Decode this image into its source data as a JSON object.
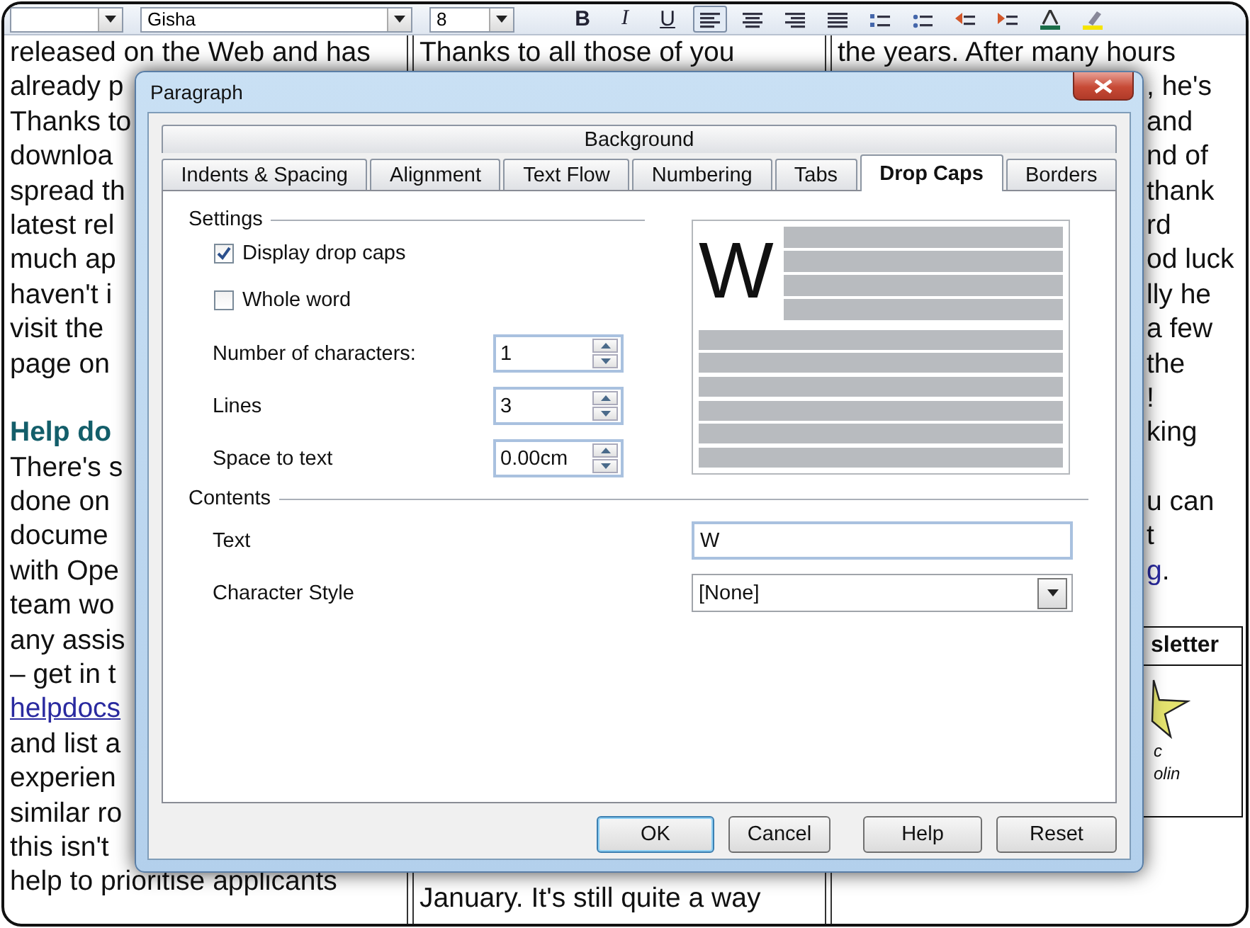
{
  "toolbar": {
    "font_name": "Gisha",
    "font_size": "8",
    "buttons": [
      {
        "kind": "bold",
        "label": "B"
      },
      {
        "kind": "italic",
        "label": "I"
      },
      {
        "kind": "underline",
        "label": "U"
      },
      {
        "kind": "align-left",
        "selected": true
      },
      {
        "kind": "align-center",
        "selected": false
      },
      {
        "kind": "align-right",
        "selected": false
      },
      {
        "kind": "justify",
        "selected": false
      },
      {
        "kind": "numbering"
      },
      {
        "kind": "bullets"
      },
      {
        "kind": "indent-less"
      },
      {
        "kind": "indent-more"
      },
      {
        "kind": "font-color"
      },
      {
        "kind": "highlight"
      }
    ]
  },
  "document": {
    "columns": [
      {
        "lines": [
          {
            "kind": "body",
            "text": "released on the Web and has"
          },
          {
            "kind": "body",
            "text": "already p"
          },
          {
            "kind": "body",
            "text": "Thanks to"
          },
          {
            "kind": "body",
            "text": "downloa"
          },
          {
            "kind": "body",
            "text": "spread th"
          },
          {
            "kind": "body",
            "text": "latest rel"
          },
          {
            "kind": "body",
            "text": "much ap"
          },
          {
            "kind": "body",
            "text": "haven't i"
          },
          {
            "kind": "body",
            "text": "visit the"
          },
          {
            "kind": "body",
            "text": "page on"
          },
          {
            "kind": "blank"
          },
          {
            "kind": "heading",
            "text": "Help do"
          },
          {
            "kind": "body",
            "text": "There's s"
          },
          {
            "kind": "body",
            "text": "done on"
          },
          {
            "kind": "body",
            "text": "docume"
          },
          {
            "kind": "body",
            "text": "with Ope"
          },
          {
            "kind": "body",
            "text": "team wo"
          },
          {
            "kind": "body",
            "text": "any assis"
          },
          {
            "kind": "body",
            "text": "– get in t"
          },
          {
            "kind": "link",
            "text": "helpdocs"
          },
          {
            "kind": "body",
            "text": "and list a"
          },
          {
            "kind": "body",
            "text": "experien"
          },
          {
            "kind": "body",
            "text": "similar ro"
          },
          {
            "kind": "body",
            "text": "this isn't"
          },
          {
            "kind": "body",
            "text": "help to prioritise applicants"
          }
        ]
      },
      {
        "lines": [
          {
            "kind": "body",
            "text": "Thanks to all those of you"
          }
        ],
        "bottom_lines": [
          {
            "kind": "body",
            "text": "January. It's still quite a way"
          }
        ]
      },
      {
        "lines": [
          {
            "kind": "body",
            "text": "the years. After many hours"
          }
        ],
        "cut_lines": [
          {
            "kind": "body",
            "text": ", he's"
          },
          {
            "kind": "body",
            "text": "and"
          },
          {
            "kind": "body",
            "text": "nd of"
          },
          {
            "kind": "body",
            "text": "thank"
          },
          {
            "kind": "body",
            "text": "rd"
          },
          {
            "kind": "body",
            "text": "od luck"
          },
          {
            "kind": "body",
            "text": "lly he"
          },
          {
            "kind": "body",
            "text": "a few"
          },
          {
            "kind": "body",
            "text": "the"
          },
          {
            "kind": "body",
            "text": "!"
          },
          {
            "kind": "body",
            "text": "king"
          },
          {
            "kind": "blank"
          },
          {
            "kind": "body",
            "text": "u can"
          },
          {
            "kind": "body",
            "text": "t"
          },
          {
            "kind": "mixed",
            "link": "g",
            "text": "."
          }
        ],
        "box": {
          "heading": "sletter",
          "caption_lines": [
            "c",
            "olin"
          ]
        }
      }
    ]
  },
  "dialog": {
    "title": "Paragraph",
    "tab_rows": [
      [
        {
          "label": "Background",
          "selected": false
        }
      ],
      [
        {
          "label": "Indents & Spacing",
          "selected": false
        },
        {
          "label": "Alignment",
          "selected": false
        },
        {
          "label": "Text Flow",
          "selected": false
        },
        {
          "label": "Numbering",
          "selected": false
        },
        {
          "label": "Tabs",
          "selected": false
        },
        {
          "label": "Drop Caps",
          "selected": true
        },
        {
          "label": "Borders",
          "selected": false
        }
      ]
    ],
    "settings": {
      "heading": "Settings",
      "checkboxes": [
        {
          "label": "Display drop caps",
          "checked": true
        },
        {
          "label": "Whole word",
          "checked": false
        }
      ],
      "spinners": [
        {
          "label": "Number of characters:",
          "value": "1"
        },
        {
          "label": "Lines",
          "value": "3"
        },
        {
          "label": "Space to text",
          "value": "0.00cm"
        }
      ]
    },
    "preview": {
      "letter": "W"
    },
    "contents": {
      "heading": "Contents",
      "text_label": "Text",
      "text_value": "W",
      "style_label": "Character Style",
      "style_value": "[None]"
    },
    "buttons": [
      {
        "label": "OK",
        "default": true
      },
      {
        "label": "Cancel",
        "default": false
      },
      {
        "label": "Help",
        "default": false
      },
      {
        "label": "Reset",
        "default": false
      }
    ]
  }
}
